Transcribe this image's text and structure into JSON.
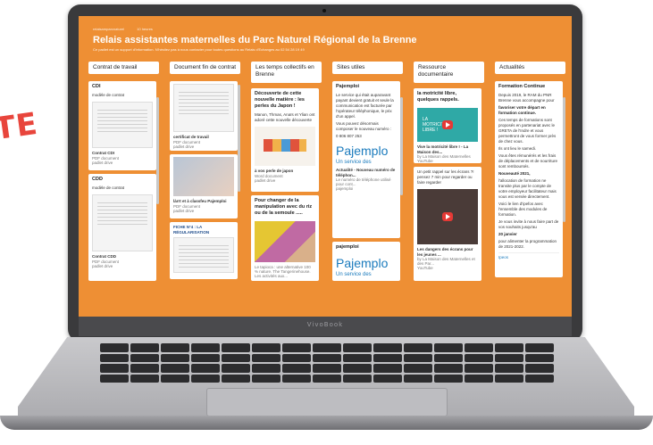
{
  "accent": "#ee8f34",
  "side_logo": "TE",
  "brand": "VivoBook",
  "header": {
    "meta_author": "relaisamparcnaturel",
    "meta_time": "10 heures",
    "title": "Relais assistantes maternelles du Parc Naturel Régional de la Brenne",
    "subtitle": "Ce padlet est un support d'information. N'hésitez pas à nous contacter pour toutes questions au Relais d'Echanges au 02 54 28 19 49"
  },
  "columns": {
    "c1": {
      "title": "Contrat de travail",
      "card1": {
        "title": "CDI",
        "body": "modèle de contrat",
        "file": "Contrat CDI",
        "type": "PDF document",
        "src": "padlet drive"
      },
      "card2": {
        "title": "CDD",
        "body": "modèle de contrat",
        "file": "Contrat CDD",
        "type": "PDF document",
        "src": "padlet drive"
      }
    },
    "c2": {
      "title": "Document fin de contrat",
      "card1": {
        "file": "certificat de travail",
        "type": "PDF document",
        "src": "padlet drive"
      },
      "card2": {
        "file": "làrrt et à cĺassfeu Pajemploi",
        "type": "PDF document",
        "src": "padlet drive"
      },
      "card3": {
        "file": "FICHE N°4 : LA RÉGULARISATION"
      }
    },
    "c3": {
      "title": "Les temps collectifs en Brenne",
      "card1": {
        "title": "Découverte de cette nouvelle matière : les perles du Japon !",
        "body": "Manon, Thmas, Anaïs et Ylian ont adoré cette nouvelle découverte",
        "file": "à vos perle de japon",
        "type": "Word document",
        "src": "padlet drive"
      },
      "card2": {
        "title": "Pour changer de la manipulation avec du riz ou de la semoule .....",
        "caption": "Le tapioca : une alternative 100 % nature. The Tangerinehouse. Les activités aux..."
      }
    },
    "c4": {
      "title": "Sites utiles",
      "card1": {
        "title": "Pajemploi",
        "body": "Le service qui était auparavant payant devient gratuit et seule la communication est facturée par l'opérateur téléphonique, le prix d'un appel.",
        "body2": "Vous pouvez désormais composer le nouveau numéro :",
        "phone": "0 806 807 253",
        "logo": "Pajemplo",
        "logo_sub": "Un service des",
        "cap1": "Actualité - Nouveau numéro de téléphon...",
        "cap2": "Le numéro de téléphone utilisé pour cont...",
        "cap3": "pajemploi"
      },
      "card2": {
        "title": "pajemploi",
        "logo": "Pajemplo",
        "logo_sub": "Un service des"
      }
    },
    "c5": {
      "title": "Ressource documentaire",
      "card1": {
        "title": "la motricité libre, quelques rappels.",
        "overlay": "LA MOTRICITÉ LIBRE !",
        "cap1": "Vive la motricité libre ! - La Maison des...",
        "cap2": "by La Maison des Maternelles",
        "cap3": "YouTube"
      },
      "card2": {
        "body": "Un petit rappel sur les écrans ?! pensez 7 min pour regarder ou faire regarder",
        "cap1": "Les dangers des écrans pour les jeunes ...",
        "cap2": "by La Maison des Maternelles et des Par...",
        "cap3": "YouTube"
      }
    },
    "c6": {
      "title": "Actualités",
      "card1": {
        "title": "Formation Continue",
        "l1": "Depuis 2019, le RAM du PNR Brenne vous accompagne pour",
        "l2": "favoriser votre départ en formation continue.",
        "l3": "Ces temps de formations sont proposés en partenariat avec le GRETA de l'Indre et vous permettront de vous former près de chez vous.",
        "l4": "Ils ont lieu le samedi.",
        "l5": "Vous êtes rémunérés et les frais de déplacements et de nourriture sont remboursés.",
        "l6": "Nouveauté 2021,",
        "l7": "l'allocation de formation ne transite plus par le compte de votre employeur facilitateur mais vous est versée directement.",
        "l8": "Voici le lien d'ipefos avec l'ensemble des modules de formation.",
        "l9": "Je vous invite à nous faire part de vos souhaits jusqu'au",
        "l10": "20 janvier",
        "l11": "pour alimenter la programmation de 2021-2022.",
        "foot": "Ipeos"
      }
    }
  }
}
